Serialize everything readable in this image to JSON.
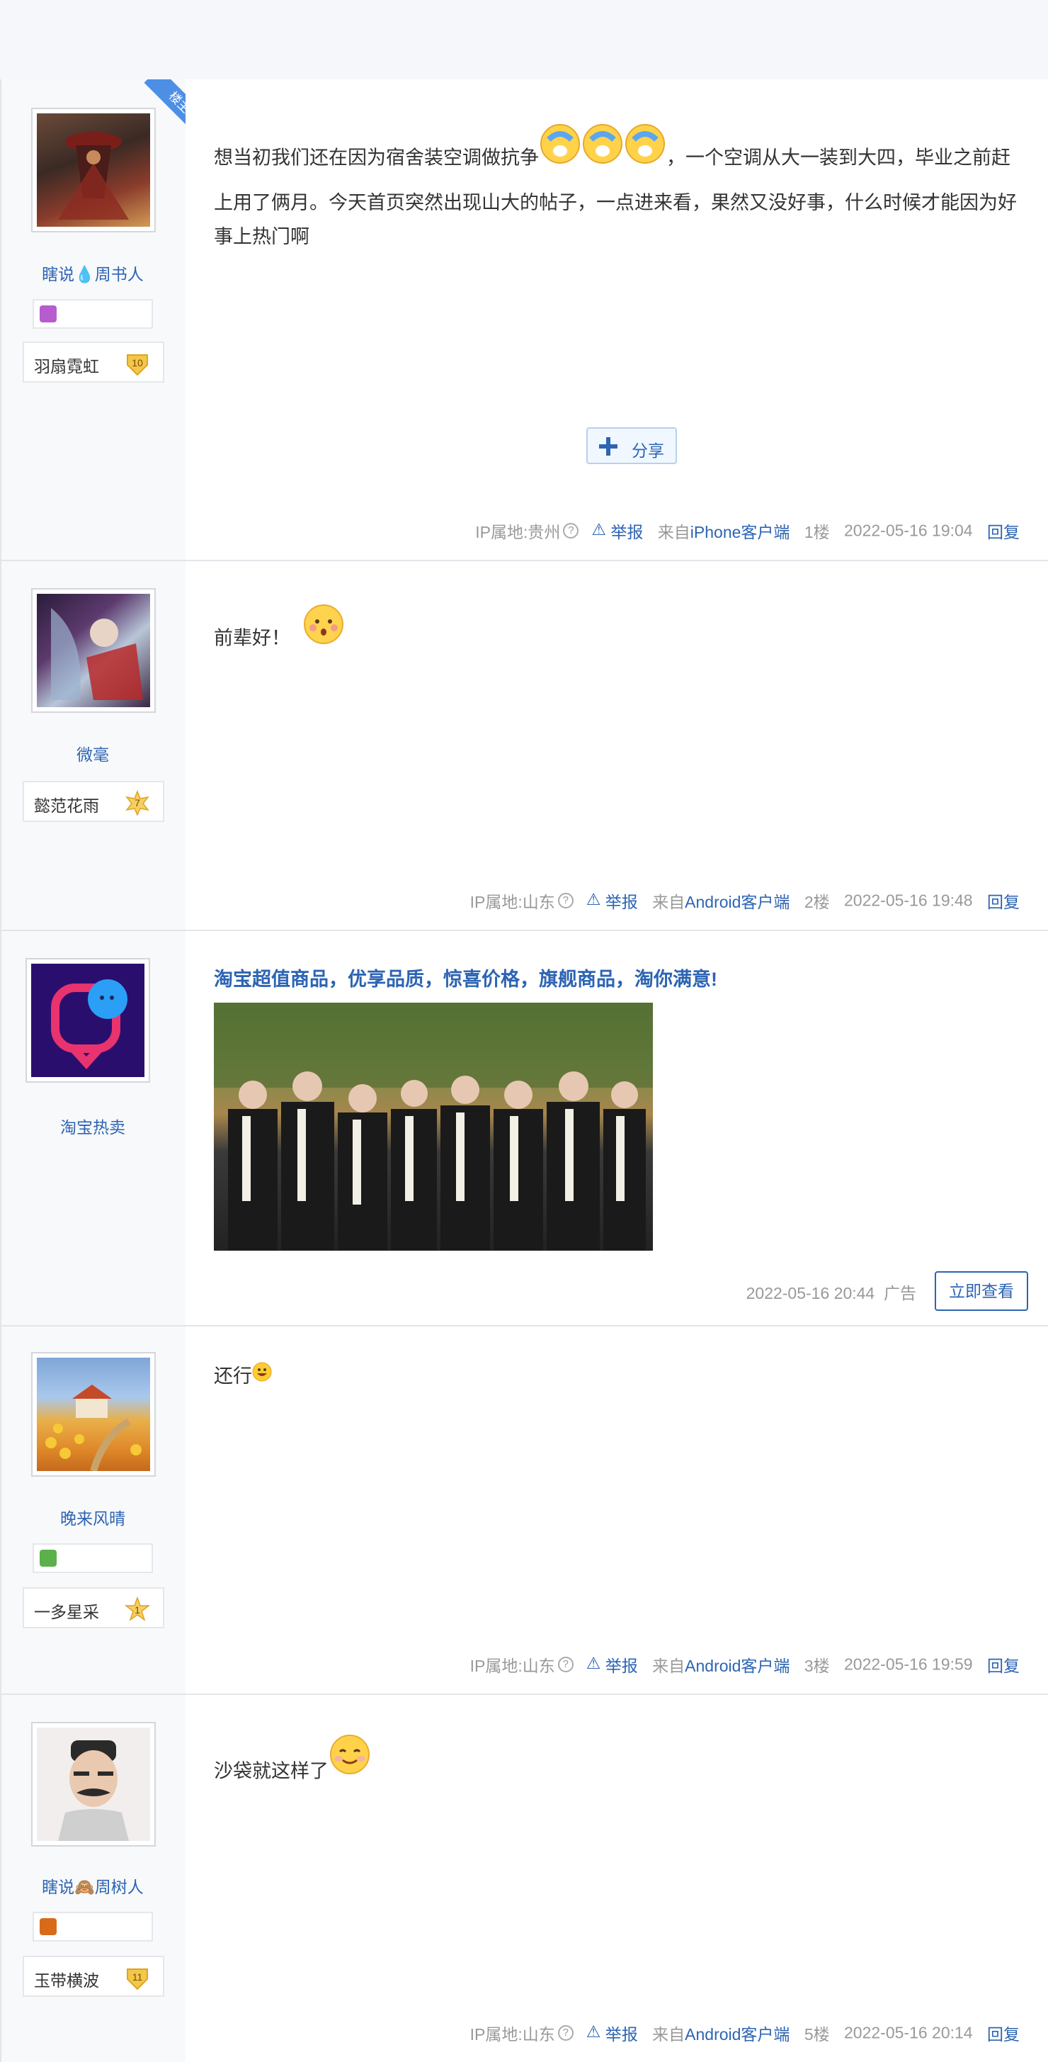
{
  "ui": {
    "ip_prefix": "IP属地:",
    "report": "举报",
    "from_prefix": "来自",
    "share": "分享",
    "ribbon": "楼主",
    "help": "?"
  },
  "posts": [
    {
      "user": "瞎说💧周书人",
      "level_name": "羽扇霓虹",
      "level": "10",
      "content": "想当初我们还在因为宿舍装空调做抗争",
      "content2": "，一个空调从大一装到大四，毕业之前赶上用了俩月。今天首页突然出现山大的帖子，一点进来看，果然又没好事，什么时候才能因为好事上热门啊",
      "ip": "贵州",
      "client": "iPhone客户端",
      "floor": "1楼",
      "time": "2022-05-16 19:04",
      "reply": "回复"
    },
    {
      "user": "微毫",
      "level_name": "懿范花雨",
      "level": "7",
      "content": "前辈好！",
      "ip": "山东",
      "client": "Android客户端",
      "floor": "2楼",
      "time": "2022-05-16 19:48",
      "reply": "回复"
    },
    {
      "user": "晚来风晴",
      "level_name": "一多星采",
      "level": "1",
      "content": "还行",
      "ip": "山东",
      "client": "Android客户端",
      "floor": "3楼",
      "time": "2022-05-16 19:59",
      "reply": "回复"
    },
    {
      "user": "瞎说🙈周树人",
      "level_name": "玉带横波",
      "level": "11",
      "content": "沙袋就这样了",
      "ip": "山东",
      "client": "Android客户端",
      "floor": "5楼",
      "time": "2022-05-16 20:14",
      "reply": "回复"
    }
  ],
  "ad": {
    "user": "淘宝热卖",
    "title": "淘宝超值商品，优享品质，惊喜价格，旗舰商品，淘你满意!",
    "time": "2022-05-16 20:44",
    "label": "广告",
    "button": "立即查看"
  },
  "colors": {
    "link": "#2d64b3",
    "meta": "#999999",
    "side_bg": "#f8f9fb",
    "ribbon": "#4e8fe6"
  }
}
